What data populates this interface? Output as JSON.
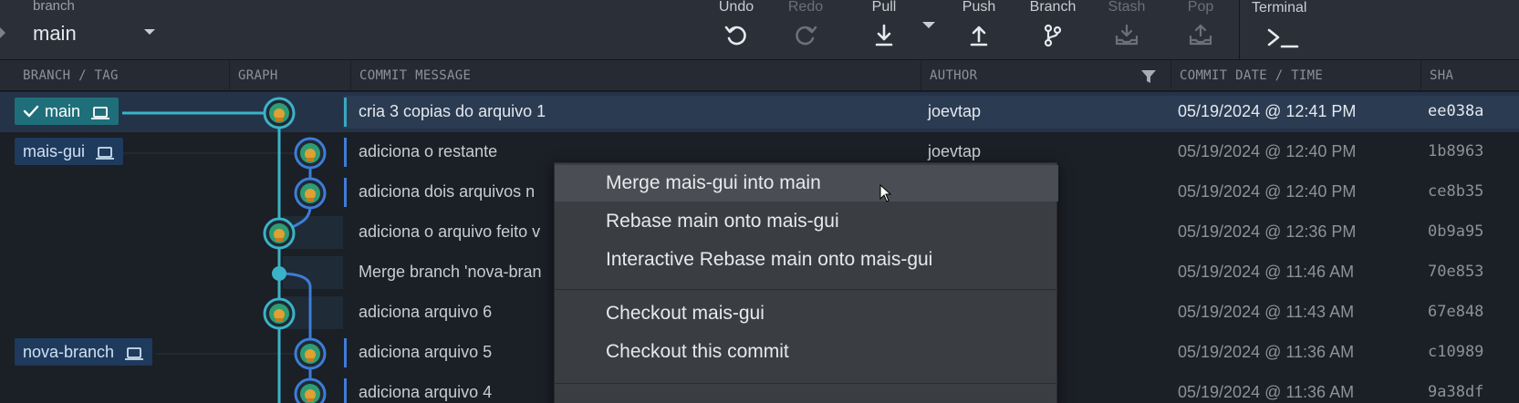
{
  "toolbar": {
    "branch_caption": "branch",
    "branch_name": "main",
    "buttons": {
      "undo": "Undo",
      "redo": "Redo",
      "pull": "Pull",
      "push": "Push",
      "branch": "Branch",
      "stash": "Stash",
      "pop": "Pop"
    },
    "terminal": "Terminal"
  },
  "columns": {
    "branch_tag": "BRANCH / TAG",
    "graph": "GRAPH",
    "commit_message": "COMMIT MESSAGE",
    "author": "AUTHOR",
    "date": "COMMIT DATE / TIME",
    "sha": "SHA"
  },
  "branches": {
    "main": "main",
    "mais_gui": "mais-gui",
    "nova_branch": "nova-branch"
  },
  "commits": [
    {
      "message": "cria 3 copias do arquivo 1",
      "author": "joevtap",
      "date": "05/19/2024 @ 12:41 PM",
      "sha": "ee038a"
    },
    {
      "message": "adiciona o restante",
      "author": "joevtap",
      "date": "05/19/2024 @ 12:40 PM",
      "sha": "1b8963"
    },
    {
      "message": "adiciona dois arquivos n",
      "author": "",
      "date": "05/19/2024 @ 12:40 PM",
      "sha": "ce8b35"
    },
    {
      "message": "adiciona o arquivo feito v",
      "author": "",
      "date": "05/19/2024 @ 12:36 PM",
      "sha": "0b9a95"
    },
    {
      "message": "Merge branch 'nova-bran",
      "author": "",
      "date": "05/19/2024 @ 11:46 AM",
      "sha": "70e853"
    },
    {
      "message": "adiciona arquivo 6",
      "author": "",
      "date": "05/19/2024 @ 11:43 AM",
      "sha": "67e848"
    },
    {
      "message": "adiciona arquivo 5",
      "author": "",
      "date": "05/19/2024 @ 11:36 AM",
      "sha": "c10989"
    },
    {
      "message": "adiciona arquivo 4",
      "author": "",
      "date": "05/19/2024 @ 11:36 AM",
      "sha": "9a38df"
    }
  ],
  "context_menu": {
    "merge": "Merge mais-gui into main",
    "rebase": "Rebase main onto mais-gui",
    "interactive_rebase": "Interactive Rebase main onto mais-gui",
    "checkout_branch": "Checkout mais-gui",
    "checkout_commit": "Checkout this commit"
  },
  "colors": {
    "toolbar_bg": "#2a2f38",
    "selected_row": "#243348",
    "graph_teal": "#3bb3c7",
    "graph_blue": "#3d7dd8",
    "main_tag": "#1f6f7a",
    "menu_bg": "#3a3d42"
  },
  "icons": {
    "undo": "undo-icon",
    "redo": "redo-icon",
    "pull": "download-arrow-icon",
    "push": "upload-arrow-icon",
    "branch": "branch-icon",
    "stash": "stash-tray-icon",
    "pop": "pop-tray-icon",
    "terminal": "terminal-prompt-icon",
    "filter": "filter-funnel-icon",
    "laptop": "laptop-icon",
    "check": "check-icon"
  }
}
